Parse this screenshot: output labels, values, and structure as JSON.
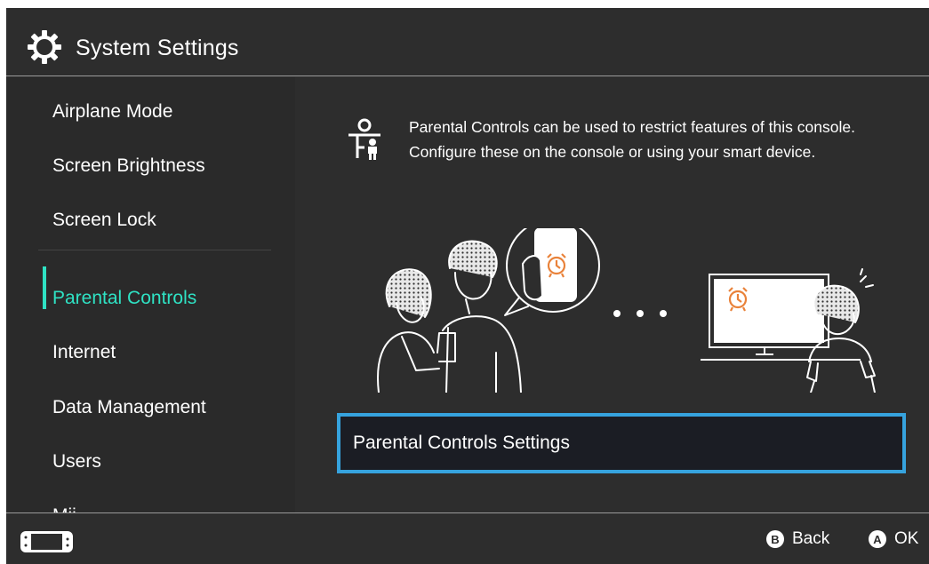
{
  "header": {
    "title": "System Settings",
    "icon": "gear-icon"
  },
  "sidebar": {
    "accent_color": "#2fe2c4",
    "items": [
      {
        "label": "Airplane Mode"
      },
      {
        "label": "Screen Brightness"
      },
      {
        "label": "Screen Lock"
      },
      {
        "label": "Parental Controls",
        "selected": true
      },
      {
        "label": "Internet"
      },
      {
        "label": "Data Management"
      },
      {
        "label": "Users"
      },
      {
        "label": "Mii"
      }
    ]
  },
  "main": {
    "icon": "parental-controls-icon",
    "description": "Parental Controls can be used to restrict features of this console. Configure these on the console or using your smart device.",
    "settings_button": {
      "label": "Parental Controls Settings",
      "border_color": "#36a3de"
    }
  },
  "footer": {
    "console_icon": "handheld-console-icon",
    "back": {
      "button": "B",
      "label": "Back"
    },
    "ok": {
      "button": "A",
      "label": "OK"
    }
  }
}
